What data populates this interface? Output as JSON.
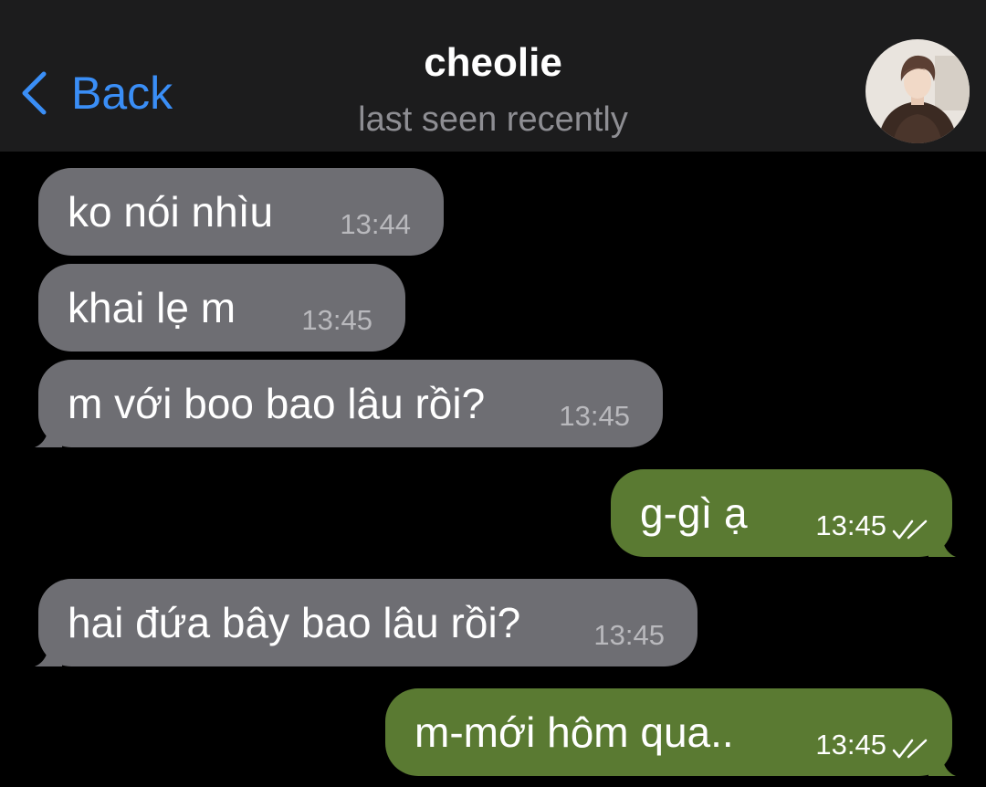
{
  "header": {
    "back_label": "Back",
    "contact_name": "cheolie",
    "status": "last seen recently"
  },
  "colors": {
    "header_bg": "#1c1c1d",
    "accent": "#3a8ef6",
    "incoming_bubble": "#6e6e73",
    "outgoing_bubble": "#5a7a32",
    "background": "#000000"
  },
  "messages": [
    {
      "direction": "incoming",
      "text": "ko nói nhìu",
      "time": "13:44"
    },
    {
      "direction": "incoming",
      "text": "khai lẹ m",
      "time": "13:45"
    },
    {
      "direction": "incoming",
      "text": "m với boo bao lâu rồi?",
      "time": "13:45"
    },
    {
      "direction": "outgoing",
      "text": "g-gì ạ",
      "time": "13:45",
      "status_icon": "double-check-icon"
    },
    {
      "direction": "incoming",
      "text": "hai đứa bây bao lâu rồi?",
      "time": "13:45"
    },
    {
      "direction": "outgoing",
      "text": "m-mới hôm qua..",
      "time": "13:45",
      "status_icon": "double-check-icon"
    }
  ]
}
